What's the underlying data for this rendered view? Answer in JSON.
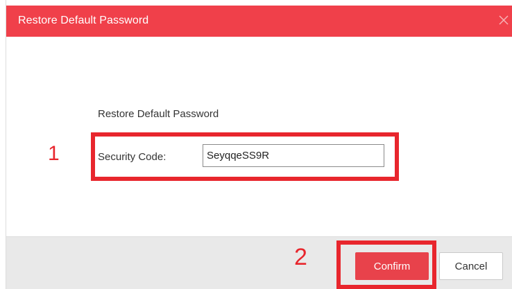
{
  "dialog": {
    "title": "Restore Default Password",
    "close_icon": "close-icon"
  },
  "form": {
    "section_label": "Restore Default Password",
    "security_code_label": "Security Code:",
    "security_code_value": "SeyqqeSS9R"
  },
  "annotations": {
    "step_1": "1",
    "step_2": "2",
    "highlight_color": "#e8262d"
  },
  "footer": {
    "confirm_label": "Confirm",
    "cancel_label": "Cancel"
  },
  "colors": {
    "titlebar": "#f0404a",
    "confirm_button": "#e8424b",
    "footer_bg": "#e9e9e9"
  }
}
